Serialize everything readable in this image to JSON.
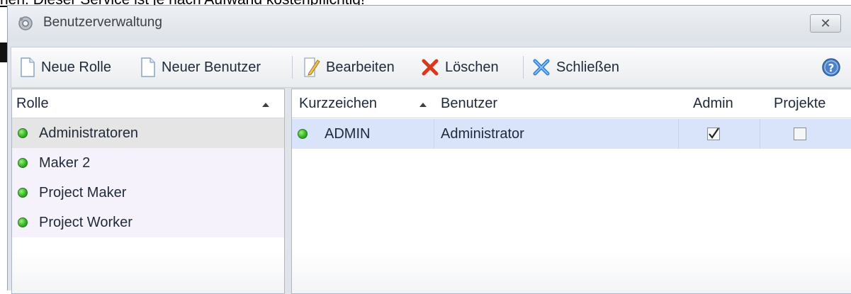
{
  "background": {
    "top_text": "hen. Dieser Service ist je nach Aufwand kostenpflichtig!"
  },
  "window": {
    "title": "Benutzerverwaltung",
    "close_label": "✕"
  },
  "toolbar": {
    "new_role": "Neue Rolle",
    "new_user": "Neuer Benutzer",
    "edit": "Bearbeiten",
    "delete": "Löschen",
    "close": "Schließen",
    "help_icon": "help-icon"
  },
  "roles": {
    "header": "Rolle",
    "items": [
      {
        "label": "Administratoren",
        "selected": true
      },
      {
        "label": "Maker 2",
        "selected": false
      },
      {
        "label": "Project Maker",
        "selected": false
      },
      {
        "label": "Project Worker",
        "selected": false
      }
    ]
  },
  "users": {
    "columns": {
      "kurzzeichen": "Kurzzeichen",
      "benutzer": "Benutzer",
      "admin": "Admin",
      "projekte": "Projekte"
    },
    "rows": [
      {
        "kurzzeichen": "ADMIN",
        "benutzer": "Administrator",
        "admin": true,
        "projekte": false
      }
    ]
  },
  "colors": {
    "selected_row": "#d9e4fb",
    "status_green": "#3cbc2e",
    "delete_red": "#d9381e",
    "close_blue": "#2f7fd9"
  }
}
